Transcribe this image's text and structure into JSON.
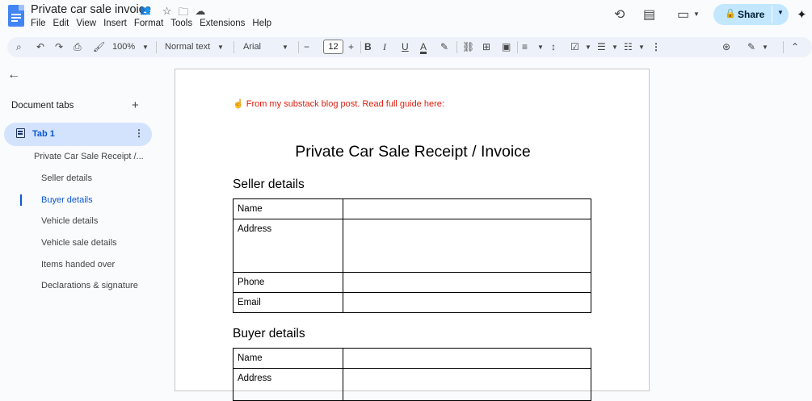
{
  "app": {
    "doc_title": "Private car sale invoice",
    "menu": [
      "File",
      "Edit",
      "View",
      "Insert",
      "Format",
      "Tools",
      "Extensions",
      "Help"
    ],
    "share_label": "Share"
  },
  "toolbar": {
    "zoom": "100%",
    "style": "Normal text",
    "font": "Arial",
    "font_size": "12"
  },
  "sidebar": {
    "heading": "Document tabs",
    "tab_label": "Tab 1",
    "outline": [
      {
        "label": "Private Car Sale Receipt /...",
        "level": 0
      },
      {
        "label": "Seller details",
        "level": 1
      },
      {
        "label": "Buyer details",
        "level": 1,
        "active": true
      },
      {
        "label": "Vehicle details",
        "level": 1
      },
      {
        "label": "Vehicle sale details",
        "level": 1
      },
      {
        "label": "Items handed over",
        "level": 1
      },
      {
        "label": "Declarations & signature",
        "level": 1
      }
    ]
  },
  "document": {
    "intro": "☝️ From my substack blog post. Read full guide here:",
    "heading": "Private Car Sale Receipt / Invoice",
    "seller": {
      "title": "Seller details",
      "rows": [
        "Name",
        "Address",
        "Phone",
        "Email"
      ]
    },
    "buyer": {
      "title": "Buyer details",
      "rows": [
        "Name",
        "Address"
      ]
    }
  },
  "colors": {
    "accent": "#0b57d0",
    "share_bg": "#c2e7ff",
    "tab_active_bg": "#d3e3fd",
    "intro_text": "#e21b0c"
  }
}
